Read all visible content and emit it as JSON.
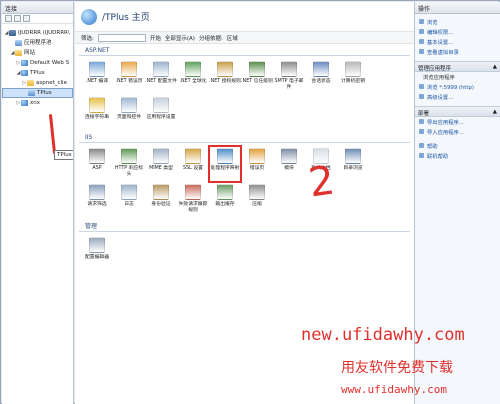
{
  "left_pane": {
    "header": "连接",
    "tree": [
      {
        "label": "IJUDRRR (IJUDRRR\\",
        "level": 0,
        "twisty": "◢",
        "icon": "server-icon"
      },
      {
        "label": "应用程序池",
        "level": 1,
        "twisty": "",
        "icon": "app-pool-icon"
      },
      {
        "label": "网站",
        "level": 1,
        "twisty": "◢",
        "icon": "folder-icon"
      },
      {
        "label": "Default Web S",
        "level": 2,
        "twisty": "▷",
        "icon": "globe-icon"
      },
      {
        "label": "TPlus",
        "level": 2,
        "twisty": "◢",
        "icon": "globe-icon"
      },
      {
        "label": "aspnet_clie",
        "level": 3,
        "twisty": "▷",
        "icon": "folder-icon"
      },
      {
        "label": "TPlus",
        "level": 3,
        "twisty": "",
        "icon": "app-icon",
        "selected": true
      },
      {
        "label": "xnx",
        "level": 2,
        "twisty": "▷",
        "icon": "globe-icon"
      }
    ],
    "tooltip": "TPlus"
  },
  "main": {
    "title": "/TPlus 主页",
    "filter_label": "筛选:",
    "filter_go": "开始",
    "show_all": "全部显示(A)",
    "group_label": "分组依据:",
    "group_value": "区域",
    "sections": [
      {
        "name": "ASP.NET",
        "features": [
          {
            "label": ".NET 编译",
            "color": "#7aa7d8"
          },
          {
            "label": ".NET 错误页",
            "color": "#e8a94b"
          },
          {
            "label": ".NET 配置文件",
            "color": "#9db4cf"
          },
          {
            "label": ".NET 全球化",
            "color": "#5fa35a"
          },
          {
            "label": ".NET 授权规则",
            "color": "#c9a04a"
          },
          {
            "label": ".NET 信任级别",
            "color": "#5b8f4b"
          },
          {
            "label": "SMTP 电子邮件",
            "color": "#8e8e8e"
          },
          {
            "label": "会话状态",
            "color": "#6a8cc2"
          },
          {
            "label": "计算机密钥",
            "color": "#b8b8b8"
          },
          {
            "label": "连接字符串",
            "color": "#e6c14a"
          },
          {
            "label": "页面和控件",
            "color": "#9fb7d4"
          },
          {
            "label": "应用程序设置",
            "color": "#c6cfdc"
          }
        ]
      },
      {
        "name": "IIS",
        "features": [
          {
            "label": "ASP",
            "color": "#8a8a8a"
          },
          {
            "label": "HTTP 响应标头",
            "color": "#5f9a55"
          },
          {
            "label": "MIME 类型",
            "color": "#a4b3c8"
          },
          {
            "label": "SSL 设置",
            "color": "#d4a646"
          },
          {
            "label": "处理程序映射",
            "color": "#4f8fc9",
            "highlighted": true
          },
          {
            "label": "错误页",
            "color": "#e2a13f"
          },
          {
            "label": "模块",
            "color": "#7e8ea6"
          },
          {
            "label": "默认文档",
            "color": "#d9dee6"
          },
          {
            "label": "目录浏览",
            "color": "#6f8db6"
          },
          {
            "label": "请求筛选",
            "color": "#8aa0bf"
          },
          {
            "label": "日志",
            "color": "#9bb2cc"
          },
          {
            "label": "身份验证",
            "color": "#b89a5e"
          },
          {
            "label": "失败请求跟踪规则",
            "color": "#c96b5b"
          },
          {
            "label": "输出缓存",
            "color": "#6a9c63"
          },
          {
            "label": "压缩",
            "color": "#8f8f8f"
          }
        ]
      },
      {
        "name": "管理",
        "features": [
          {
            "label": "配置编辑器",
            "color": "#9aa9bd"
          }
        ]
      }
    ]
  },
  "right_pane": {
    "header": "操作",
    "top_links": [
      "浏览",
      "编辑权限...",
      "基本设置...",
      "查看虚拟目录"
    ],
    "manage_section": "管理应用程序",
    "browse_label": "浏览应用程序",
    "browse_link": "浏览 *:5999 (http)",
    "advanced": "高级设置...",
    "deploy_section": "部署",
    "deploy_links": [
      "导出应用程序...",
      "导入应用程序..."
    ],
    "help_links": [
      "帮助",
      "联机帮助"
    ]
  },
  "annotations": {
    "number": "2",
    "watermark_url": "new.ufidawhy.com",
    "watermark_cn": "用友软件免费下载",
    "watermark_url2": "www.ufidawhy.com"
  }
}
